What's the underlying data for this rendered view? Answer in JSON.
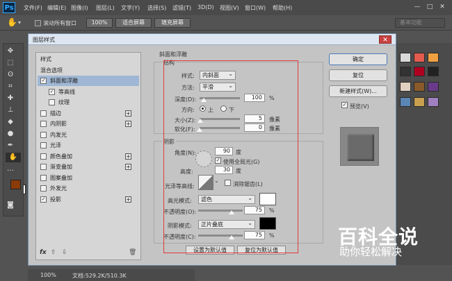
{
  "app": {
    "logo": "Ps"
  },
  "menu": [
    "文件(F)",
    "编辑(E)",
    "图像(I)",
    "图层(L)",
    "文字(Y)",
    "选择(S)",
    "滤镜(T)",
    "3D(D)",
    "视图(V)",
    "窗口(W)",
    "帮助(H)"
  ],
  "options_bar": {
    "scroll_all_label": "滚动所有窗口",
    "zoom_value": "100%",
    "fit_screen_label": "适合屏幕",
    "fill_screen_label": "填充屏幕",
    "workspace": "基本功能"
  },
  "status_bar": {
    "zoom": "100%",
    "doc": "文档:529.2K/510.3K"
  },
  "dialog": {
    "title": "图层样式",
    "left_list": [
      {
        "label": "样式",
        "checkbox": false,
        "checked": false,
        "plus": false,
        "active": false
      },
      {
        "label": "混合选项",
        "checkbox": false,
        "checked": false,
        "plus": false,
        "active": false
      },
      {
        "label": "斜面和浮雕",
        "checkbox": true,
        "checked": true,
        "plus": false,
        "active": true
      },
      {
        "label": "等高线",
        "checkbox": true,
        "checked": true,
        "plus": false,
        "active": false
      },
      {
        "label": "纹理",
        "checkbox": true,
        "checked": false,
        "plus": false,
        "active": false
      },
      {
        "label": "描边",
        "checkbox": true,
        "checked": false,
        "plus": true,
        "active": false
      },
      {
        "label": "内阴影",
        "checkbox": true,
        "checked": false,
        "plus": true,
        "active": false
      },
      {
        "label": "内发光",
        "checkbox": true,
        "checked": false,
        "plus": false,
        "active": false
      },
      {
        "label": "光泽",
        "checkbox": true,
        "checked": false,
        "plus": false,
        "active": false
      },
      {
        "label": "颜色叠加",
        "checkbox": true,
        "checked": false,
        "plus": true,
        "active": false
      },
      {
        "label": "渐变叠加",
        "checkbox": true,
        "checked": false,
        "plus": true,
        "active": false
      },
      {
        "label": "图案叠加",
        "checkbox": true,
        "checked": false,
        "plus": false,
        "active": false
      },
      {
        "label": "外发光",
        "checkbox": true,
        "checked": false,
        "plus": false,
        "active": false
      },
      {
        "label": "投影",
        "checkbox": true,
        "checked": true,
        "plus": true,
        "active": false
      }
    ],
    "footer": {
      "fx": "fx"
    },
    "bevel": {
      "header": "斜面和浮雕",
      "structure_label": "结构",
      "style_label": "样式:",
      "style_value": "内斜面",
      "method_label": "方法:",
      "method_value": "平滑",
      "depth_label": "深度(D):",
      "depth_value": "100",
      "depth_unit": "%",
      "direction_label": "方向:",
      "dir_up": "上",
      "dir_down": "下",
      "size_label": "大小(Z):",
      "size_value": "5",
      "size_unit": "像素",
      "soften_label": "软化(F):",
      "soften_value": "0",
      "soften_unit": "像素"
    },
    "shading": {
      "label": "阴影",
      "angle_label": "角度(N):",
      "angle_value": "90",
      "angle_unit": "度",
      "global_light_label": "使用全局光(G)",
      "altitude_label": "高度:",
      "altitude_value": "30",
      "altitude_unit": "度",
      "gloss_label": "光泽等高线:",
      "antialias_label": "消除锯齿(L)",
      "highlight_mode_label": "高光模式:",
      "highlight_mode": "滤色",
      "highlight_color": "#ffffff",
      "opacity1_label": "不透明度(O):",
      "opacity1_value": "75",
      "opacity1_unit": "%",
      "shadow_mode_label": "阴影模式:",
      "shadow_mode": "正片叠底",
      "shadow_color": "#000000",
      "opacity2_label": "不透明度(C):",
      "opacity2_value": "75",
      "opacity2_unit": "%"
    },
    "bottom_buttons": {
      "set_default": "设置为默认值",
      "reset_default": "复位为默认值"
    },
    "right_buttons": {
      "ok": "确定",
      "reset": "复位",
      "new_style": "新建样式(W)...",
      "preview": "预览(V)"
    }
  },
  "watermark": {
    "text": "百科全说",
    "sub": "助你轻松解决"
  },
  "colors": {
    "foreground": "#8a3b08",
    "background": "#ffffff",
    "accent_red": "#e03a3a"
  }
}
